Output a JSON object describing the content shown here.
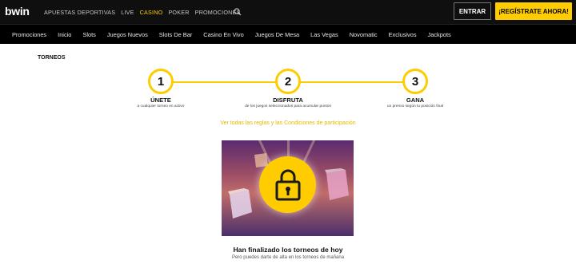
{
  "header": {
    "logo": "bwin",
    "nav": [
      {
        "label": "APUESTAS DEPORTIVAS",
        "active": false
      },
      {
        "label": "LIVE",
        "active": false
      },
      {
        "label": "CASINO",
        "active": true
      },
      {
        "label": "POKER",
        "active": false
      },
      {
        "label": "PROMOCIONES",
        "active": false
      }
    ],
    "search_icon": "search-icon",
    "login_label": "ENTRAR",
    "register_label": "¡REGÍSTRATE AHORA!"
  },
  "subnav": {
    "items": [
      "Promociones",
      "Inicio",
      "Slots",
      "Juegos Nuevos",
      "Slots De Bar",
      "Casino En Vivo",
      "Juegos De Mesa",
      "Las Vegas",
      "Novomatic",
      "Exclusivos",
      "Jackpots"
    ]
  },
  "main": {
    "section_title": "TORNEOS",
    "steps": [
      {
        "number": "1",
        "title": "ÚNETE",
        "desc": "a cualquier torneo en activo"
      },
      {
        "number": "2",
        "title": "DISFRUTA",
        "desc": "de los juegos seleccionados para acumular puntos"
      },
      {
        "number": "3",
        "title": "GANA",
        "desc": "un premio según tu posición final"
      }
    ],
    "rules_link": "Ver todas las reglas y las Condiciones de participación",
    "banner_icon": "lock-icon",
    "ended_title": "Han finalizado los torneos de hoy",
    "ended_subtitle": "Pero puedes darte de alta en los torneos de mañana"
  },
  "colors": {
    "accent": "#ffcc00",
    "header_bg": "#0f0f0f",
    "subnav_bg": "#000000"
  }
}
